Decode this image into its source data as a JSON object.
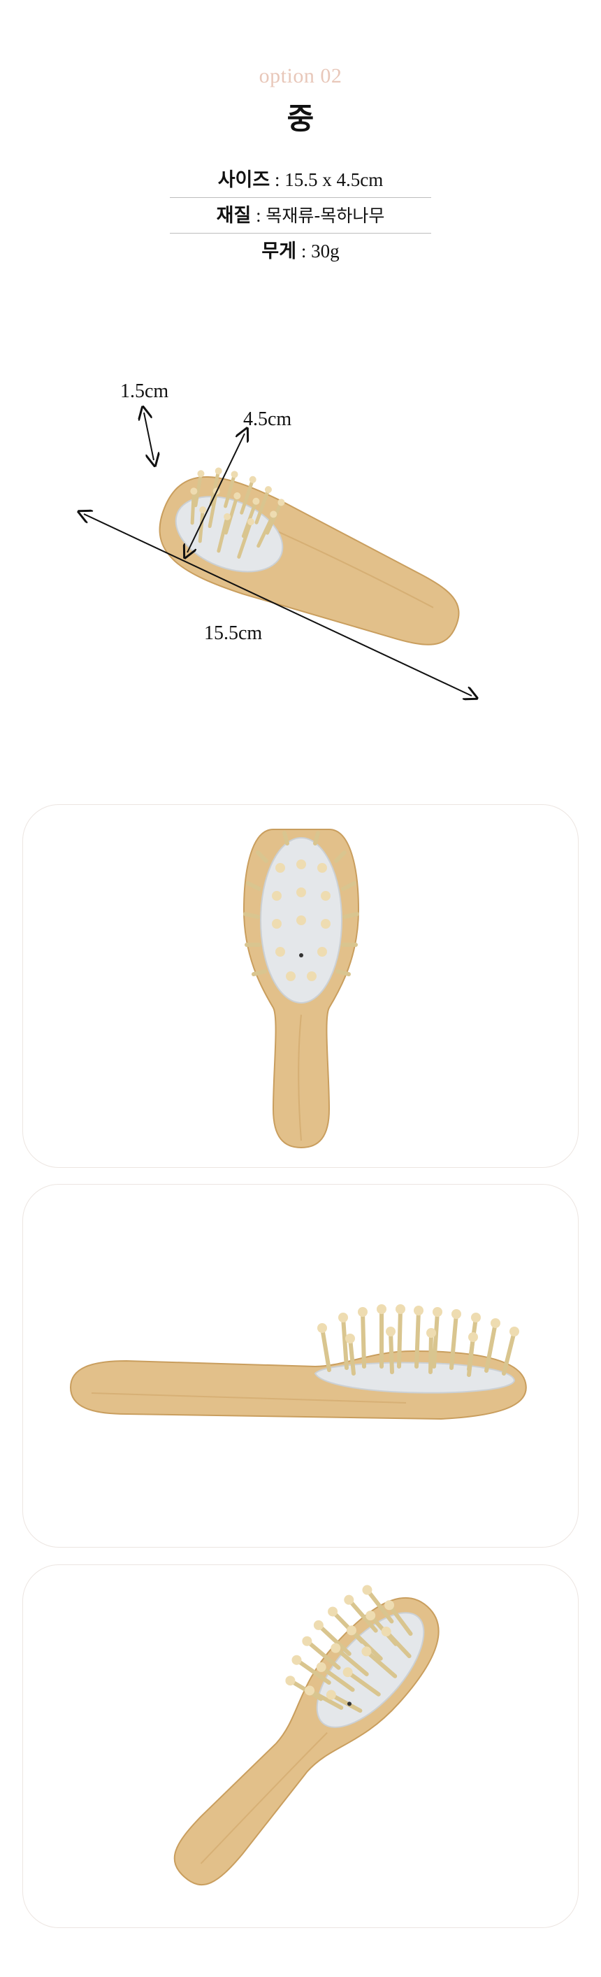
{
  "header": {
    "option_label": "option 02",
    "option_title": "중"
  },
  "specs": [
    {
      "key": "사이즈",
      "sep": " : ",
      "value": "15.5 x 4.5cm"
    },
    {
      "key": "재질",
      "sep": " : ",
      "value": "목재류-목하나무"
    },
    {
      "key": "무게",
      "sep": " : ",
      "value": "30g"
    }
  ],
  "dimension_figure": {
    "bristle_height": "1.5cm",
    "head_width": "4.5cm",
    "total_length": "15.5cm"
  },
  "colors": {
    "option_label": "#e8c7b9",
    "wood": "#e2c08a",
    "wood_dark": "#c99e5e",
    "pad": "#e4e7ea",
    "pin": "#eedcb1",
    "card_border": "#ece5e1"
  },
  "photos": [
    {
      "name": "brush-front-view",
      "orientation": "vertical"
    },
    {
      "name": "brush-side-view",
      "orientation": "horizontal"
    },
    {
      "name": "brush-angled-view",
      "orientation": "diagonal"
    }
  ]
}
